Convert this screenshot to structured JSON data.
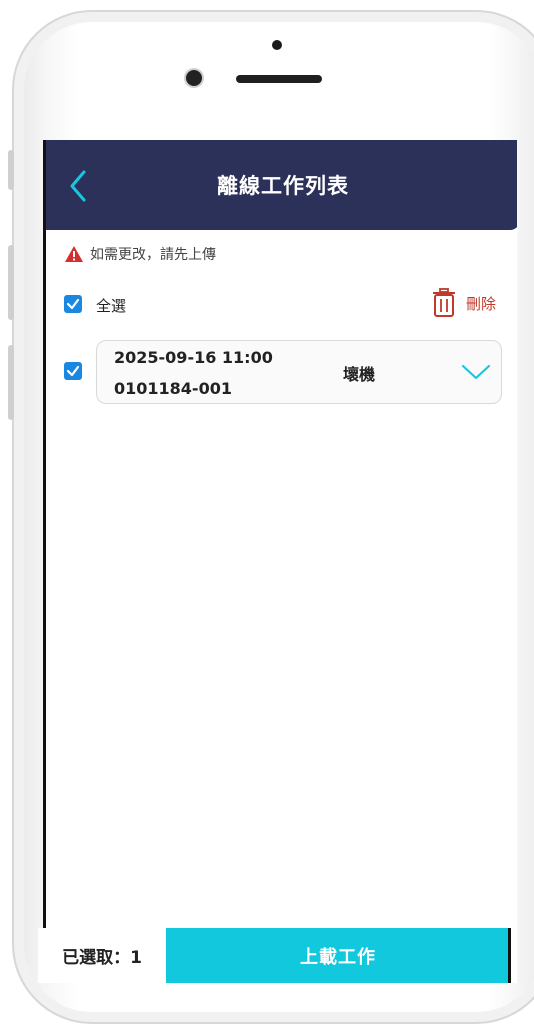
{
  "header": {
    "title": "離線工作列表",
    "back_icon": "chevron-left-icon"
  },
  "warning": {
    "icon": "warning-triangle-icon",
    "text": "如需更改，請先上傳",
    "color": "#d32f2f"
  },
  "select_all": {
    "label": "全選",
    "checked": true
  },
  "delete": {
    "label": "刪除",
    "icon": "trash-icon",
    "color": "#c0392b"
  },
  "jobs": [
    {
      "checked": true,
      "datetime": "2025-09-16 11:00",
      "code": "0101184-001",
      "status": "壞機",
      "expand_icon": "chevron-down-icon"
    }
  ],
  "footer": {
    "selected_label": "已選取：1",
    "upload_label": "上載工作"
  },
  "colors": {
    "header_bg": "#2b3158",
    "accent": "#12c8dc",
    "checkbox": "#1a88e0"
  }
}
